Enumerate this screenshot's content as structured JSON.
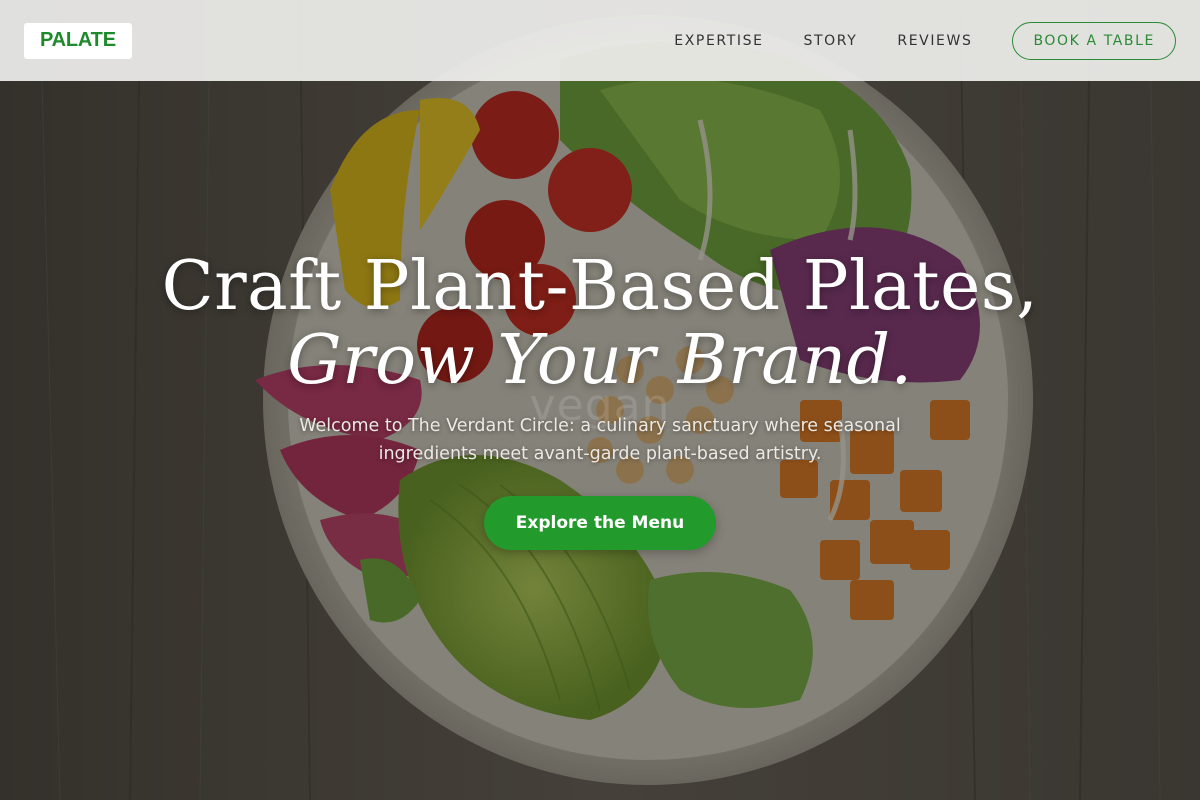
{
  "header": {
    "logo": "PALATE",
    "nav": [
      "EXPERTISE",
      "STORY",
      "REVIEWS"
    ],
    "cta_label": "BOOK A TABLE"
  },
  "hero": {
    "headline_line1": "Craft Plant-Based Plates,",
    "headline_line2": "Grow Your Brand.",
    "subtitle": "Welcome to The Verdant Circle: a culinary sanctuary where seasonal ingredients meet avant-garde plant-based artistry.",
    "cta_label": "Explore the Menu",
    "background_image": "salad-bowl-on-wooden-table",
    "watermark": "vegan"
  },
  "colors": {
    "brand_green": "#1e8a2c",
    "cta_green": "#239a2c",
    "header_bg": "#eeeeec",
    "wood": "#5a524a"
  }
}
